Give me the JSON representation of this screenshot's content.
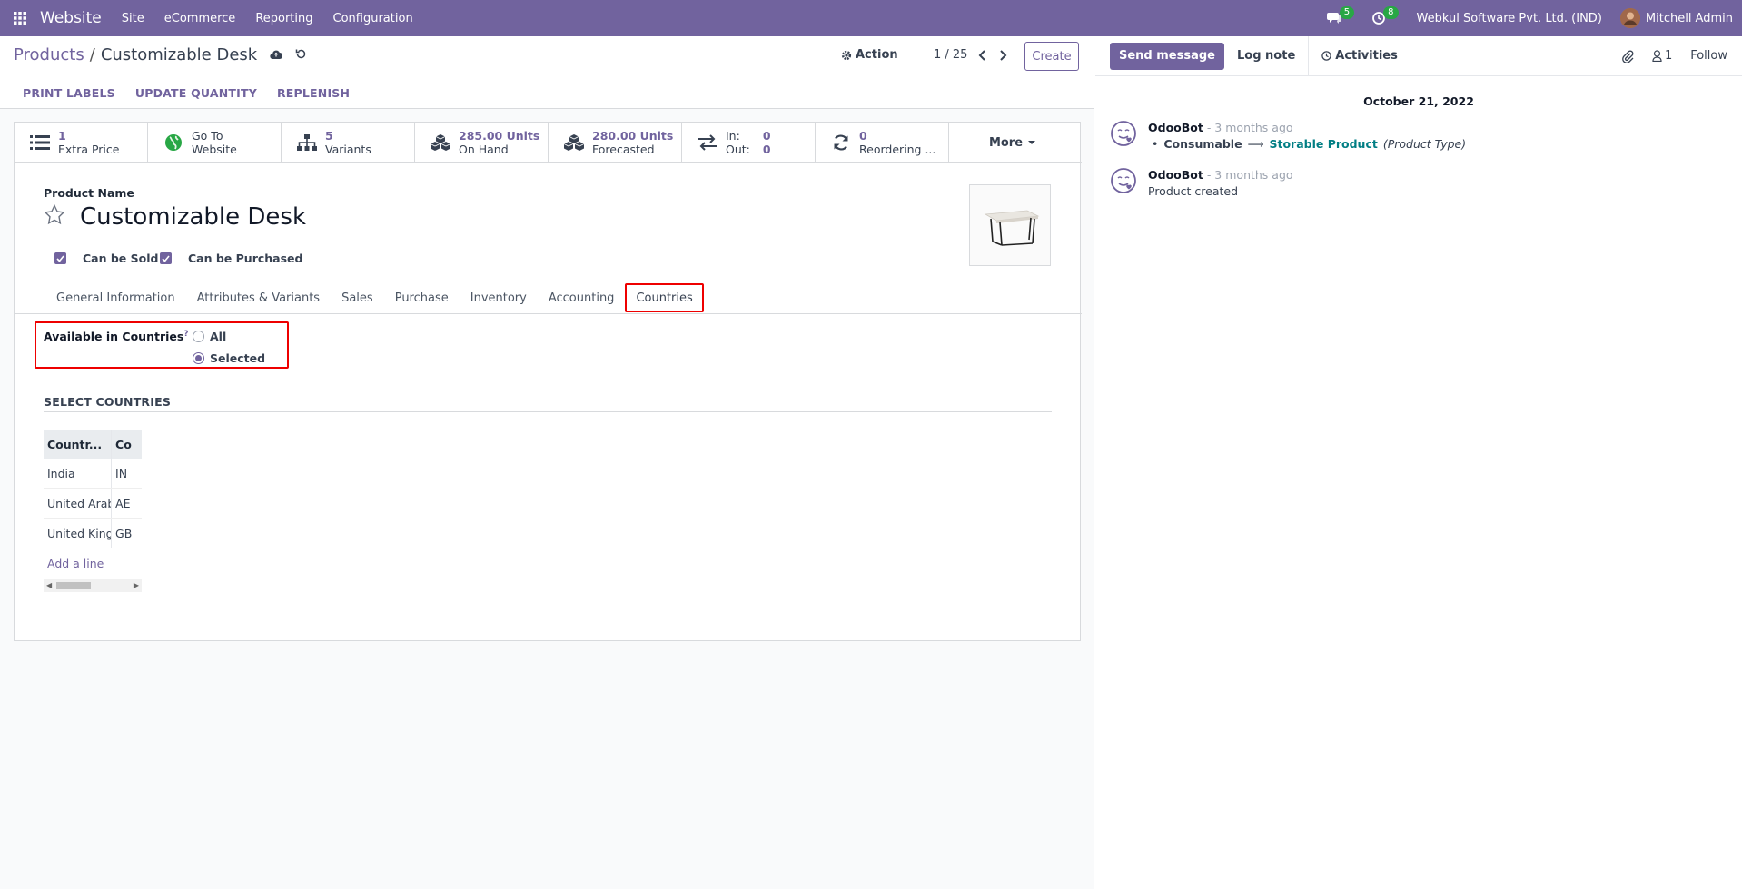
{
  "topbar": {
    "app_name": "Website",
    "menus": [
      "Site",
      "eCommerce",
      "Reporting",
      "Configuration"
    ],
    "messages_count": "5",
    "activities_count": "8",
    "company": "Webkul Software Pvt. Ltd. (IND)",
    "user": "Mitchell Admin",
    "accent_color": "#71639e"
  },
  "breadcrumb": {
    "parent": "Products",
    "separator": "/",
    "current": "Customizable Desk"
  },
  "control": {
    "action_label": "Action",
    "pager": "1 / 25",
    "create_label": "Create"
  },
  "statusbar": {
    "print_labels": "PRINT LABELS",
    "update_quantity": "UPDATE QUANTITY",
    "replenish": "REPLENISH"
  },
  "smart_buttons": {
    "extra_price": {
      "value": "1",
      "label": "Extra Price"
    },
    "website": {
      "value": "Go To",
      "label": "Website"
    },
    "variants": {
      "value": "5",
      "label": "Variants"
    },
    "on_hand": {
      "value": "285.00 Units",
      "label": "On Hand"
    },
    "forecasted": {
      "value": "280.00 Units",
      "label": "Forecasted"
    },
    "in_out": {
      "in_label": "In:",
      "in_value": "0",
      "out_label": "Out:",
      "out_value": "0"
    },
    "reordering": {
      "value": "0",
      "label": "Reordering ..."
    },
    "more": "More"
  },
  "product": {
    "name_label": "Product Name",
    "name": "Customizable Desk",
    "can_be_sold": "Can be Sold",
    "can_be_purchased": "Can be Purchased"
  },
  "tabs": [
    "General Information",
    "Attributes & Variants",
    "Sales",
    "Purchase",
    "Inventory",
    "Accounting",
    "Countries"
  ],
  "countries": {
    "available_label": "Available in Countries",
    "help_mark": "?",
    "option_all": "All",
    "option_selected": "Selected",
    "selected_option": "Selected",
    "select_title": "SELECT COUNTRIES",
    "columns": [
      "Countr...",
      "Co"
    ],
    "rows": [
      {
        "country": "India",
        "code": "IN"
      },
      {
        "country": "United Arab...",
        "code": "AE"
      },
      {
        "country": "United King...",
        "code": "GB"
      }
    ],
    "add_line": "Add a line"
  },
  "chatter": {
    "send_message": "Send message",
    "log_note": "Log note",
    "activities": "Activities",
    "followers_count": "1",
    "follow": "Follow",
    "date_separator": "October 21, 2022",
    "messages": [
      {
        "author": "OdooBot",
        "date": "- 3 months ago",
        "old_value": "Consumable",
        "arrow": "⟶",
        "new_value": "Storable Product",
        "field": "(Product Type)"
      },
      {
        "author": "OdooBot",
        "date": "- 3 months ago",
        "body": "Product created"
      }
    ]
  }
}
